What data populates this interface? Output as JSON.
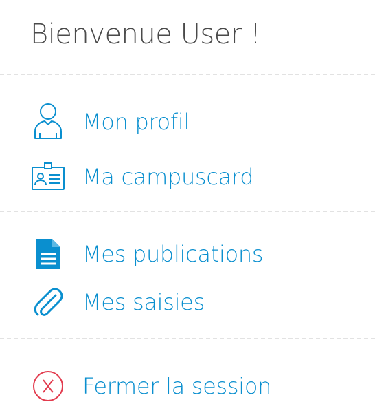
{
  "header": {
    "greeting": "Bienvenue User !"
  },
  "menu": {
    "items": [
      {
        "label": "Mon profil",
        "icon": "user-icon"
      },
      {
        "label": "Ma campuscard",
        "icon": "id-card-icon"
      },
      {
        "label": "Mes publications",
        "icon": "document-icon"
      },
      {
        "label": "Mes saisies",
        "icon": "paperclip-icon"
      },
      {
        "label": "Fermer la session",
        "icon": "close-circle-icon"
      }
    ]
  },
  "colors": {
    "accent": "#0a8fcf",
    "logout_icon": "#e23b4e",
    "text_dark": "#4a4a4a",
    "divider": "#e2e2e2"
  }
}
